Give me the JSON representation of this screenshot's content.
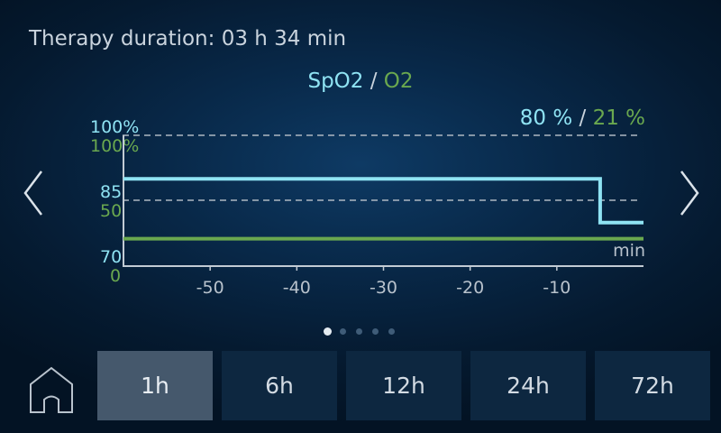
{
  "header": {
    "therapy_duration": "Therapy duration: 03 h 34 min"
  },
  "chart": {
    "title_spo2": "SpO2",
    "title_separator": " / ",
    "title_o2": "O2",
    "current_spo2": "80 %",
    "current_separator": " / ",
    "current_o2": "21 %",
    "y_spo2_top": "100%",
    "y_o2_top": "100%",
    "y_spo2_mid": "85",
    "y_o2_mid": "50",
    "y_spo2_bottom": "70",
    "y_o2_bottom": "0",
    "x_unit": "min",
    "x_ticks": [
      "-50",
      "-40",
      "-30",
      "-20",
      "-10"
    ]
  },
  "chart_data": {
    "type": "line",
    "x_unit": "min",
    "x_ticks": [
      -50,
      -40,
      -30,
      -20,
      -10
    ],
    "xlim": [
      -60,
      0
    ],
    "series": [
      {
        "name": "SpO2",
        "color": "#8fe3f3",
        "ylim": [
          70,
          100
        ],
        "points": [
          [
            -60,
            90
          ],
          [
            -5,
            90
          ],
          [
            -5,
            80
          ],
          [
            0,
            80
          ]
        ]
      },
      {
        "name": "O2",
        "color": "#6aa84f",
        "ylim": [
          0,
          100
        ],
        "points": [
          [
            -60,
            21
          ],
          [
            0,
            21
          ]
        ]
      }
    ],
    "reference_lines": {
      "spo2": [
        100,
        85
      ],
      "o2": [
        100,
        50
      ]
    },
    "grid": "dashed reference lines"
  },
  "pager": {
    "page_count": 5,
    "active_index": 0
  },
  "time_ranges": [
    {
      "label": "1h",
      "selected": true
    },
    {
      "label": "6h",
      "selected": false
    },
    {
      "label": "12h",
      "selected": false
    },
    {
      "label": "24h",
      "selected": false
    },
    {
      "label": "72h",
      "selected": false
    }
  ],
  "icons": {
    "home": "home-icon",
    "prev": "chevron-left-icon",
    "next": "chevron-right-icon"
  },
  "colors": {
    "spo2": "#8fe3f3",
    "o2": "#6aa84f",
    "selected_button": "#45586c",
    "button": "#0d2740"
  }
}
